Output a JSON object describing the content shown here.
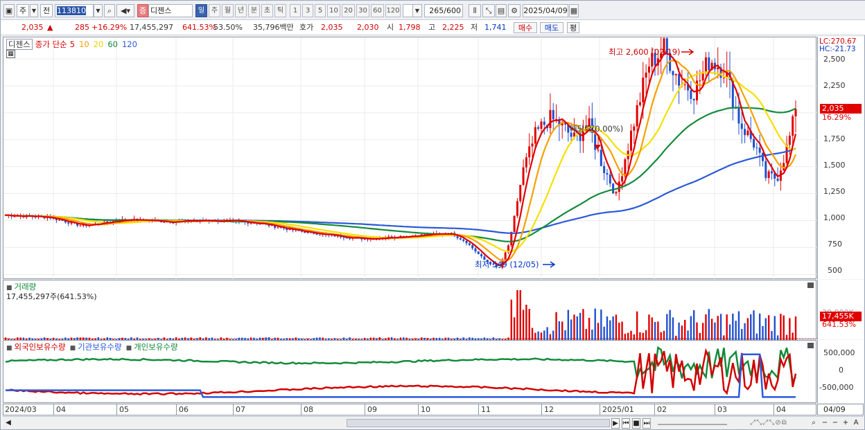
{
  "toolbar": {
    "type_label": "주",
    "mode_label": "전",
    "code_value": "113810",
    "badge_label": "증",
    "stock_name": "디젠스",
    "periods": [
      "일",
      "주",
      "월",
      "년",
      "분",
      "초",
      "틱"
    ],
    "active_period": "일",
    "intervals": [
      "1",
      "3",
      "5",
      "10",
      "20",
      "30",
      "60",
      "120"
    ],
    "count_value": "265",
    "count_total": "/600",
    "date_value": "2025/04/09"
  },
  "quote": {
    "price": "2,035",
    "up_arrow": "▲",
    "change": "285",
    "change_pct": "+16.29%",
    "volume": "17,455,297",
    "volume_pct": "641.53%",
    "ratio": "53.50%",
    "amount": "35,796백만",
    "ask_label": "호가",
    "ask1": "2,035",
    "ask2": "2,030",
    "open_label": "시",
    "open": "1,798",
    "high_label": "고",
    "high": "2,225",
    "low_label": "저",
    "low": "1,741",
    "buy_label": "매수",
    "sell_label": "매도",
    "eval_label": "평"
  },
  "price_panel": {
    "stock_tag": "디젠스",
    "legend_title": "종가 단순",
    "ma_labels": [
      "5",
      "10",
      "20",
      "60",
      "120"
    ],
    "ma_colors": [
      "#e00000",
      "#f5a000",
      "#f5e000",
      "#138a3a",
      "#2a59d8"
    ],
    "y_ticks": [
      "2,500",
      "2,250",
      "2,000",
      "1,750",
      "1,500",
      "1,250",
      "1,000",
      "750",
      "500"
    ],
    "lc_label": "LC:270.67",
    "hc_label": "HC:-21.73",
    "high_annot": "최고 2,600 (02/19)",
    "low_annot": "최저 549 (12/05)",
    "dividend_annot": "배당락(0.00%)",
    "price_tag": "2,035",
    "pct_tag": "16.29%"
  },
  "volume_panel": {
    "title": "거래량",
    "value_label": "17,455,297주(641.53%)",
    "axis_label": "30,000K",
    "vol_tag": "17,455K",
    "vol_pct_tag": "641.53%"
  },
  "holding_panel": {
    "legends": [
      "외국인보유수량",
      "기관보유수량",
      "개인보유수량"
    ],
    "legend_colors": [
      "#d20000",
      "#2a59d8",
      "#138a3a"
    ],
    "y_ticks": [
      "500,000",
      "0",
      "-500,000"
    ]
  },
  "x_axis": {
    "labels": [
      "2024/03",
      "04",
      "05",
      "06",
      "07",
      "08",
      "09",
      "10",
      "11",
      "12",
      "2025/01",
      "02",
      "03",
      "04"
    ],
    "right_label": "04/09"
  },
  "chart_data": {
    "type": "candlestick",
    "y_range": [
      450,
      2700
    ],
    "key_points": [
      {
        "label": "최고",
        "value": 2600,
        "date": "02/19"
      },
      {
        "label": "최저",
        "value": 549,
        "date": "12/05"
      }
    ],
    "last": {
      "close": 2035,
      "open": 1798,
      "high": 2225,
      "low": 1741,
      "change_pct": 16.29
    }
  }
}
